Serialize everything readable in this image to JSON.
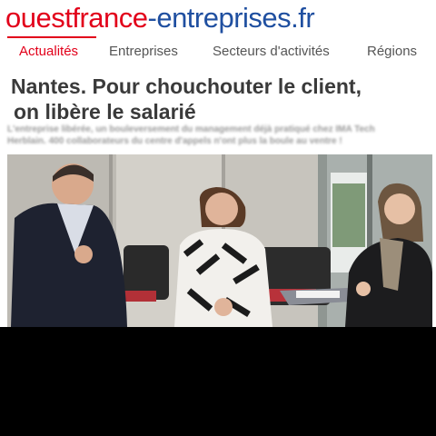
{
  "site": {
    "logo_part1": "ouestfrance",
    "logo_part2": "-entreprises.fr"
  },
  "nav": {
    "tabs": [
      {
        "label": "Actualités",
        "active": true
      },
      {
        "label": "Entreprises",
        "active": false
      },
      {
        "label": "Secteurs d'activités",
        "active": false
      },
      {
        "label": "Régions",
        "active": false
      }
    ]
  },
  "article": {
    "title_line1": "Nantes. Pour chouchouter le client,",
    "title_line2": "on libère le salarié",
    "summary_line1": "L'entreprise libérée, un bouleversement du management déjà pratiqué chez IMA Tech",
    "summary_line2": "Herblain. 400 collaborateurs du centre d'appels n'ont plus la boule au ventre !"
  },
  "colors": {
    "brand_red": "#e2001a",
    "brand_blue": "#1f4fa0",
    "headline_gray": "#3a3a3a"
  }
}
